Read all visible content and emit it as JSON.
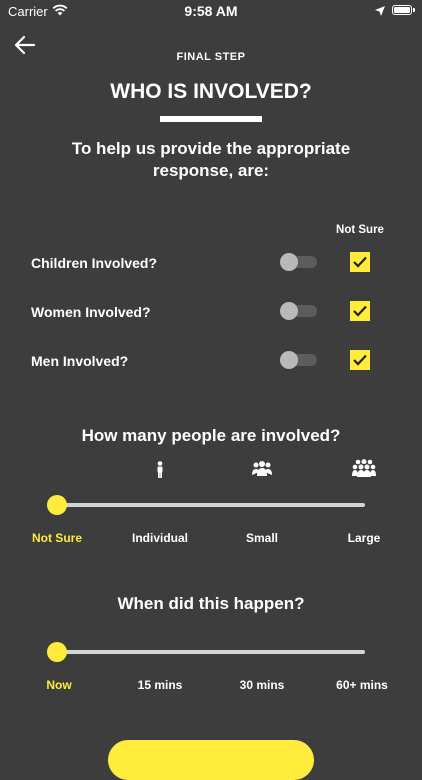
{
  "status": {
    "carrier": "Carrier",
    "time": "9:58 AM"
  },
  "header": {
    "step": "FINAL STEP",
    "title": "WHO IS INVOLVED?"
  },
  "intro": "To help us provide the appropriate response, are:",
  "not_sure_header": "Not Sure",
  "questions": [
    {
      "label": "Children Involved?",
      "toggle_on": false,
      "not_sure_checked": true
    },
    {
      "label": "Women Involved?",
      "toggle_on": false,
      "not_sure_checked": true
    },
    {
      "label": "Men Involved?",
      "toggle_on": false,
      "not_sure_checked": true
    }
  ],
  "people": {
    "question": "How many people are involved?",
    "options": [
      "Not Sure",
      "Individual",
      "Small",
      "Large"
    ],
    "icons": [
      "person-icon",
      "small-group-icon",
      "large-group-icon"
    ],
    "selected_index": 0,
    "value_fraction": 0.0
  },
  "time": {
    "question": "When did this happen?",
    "options": [
      "Now",
      "15 mins",
      "30 mins",
      "60+ mins"
    ],
    "selected_index": 0,
    "value_fraction": 0.0
  },
  "colors": {
    "background": "#3d3d3d",
    "accent": "#ffec3d",
    "text": "#ffffff"
  }
}
